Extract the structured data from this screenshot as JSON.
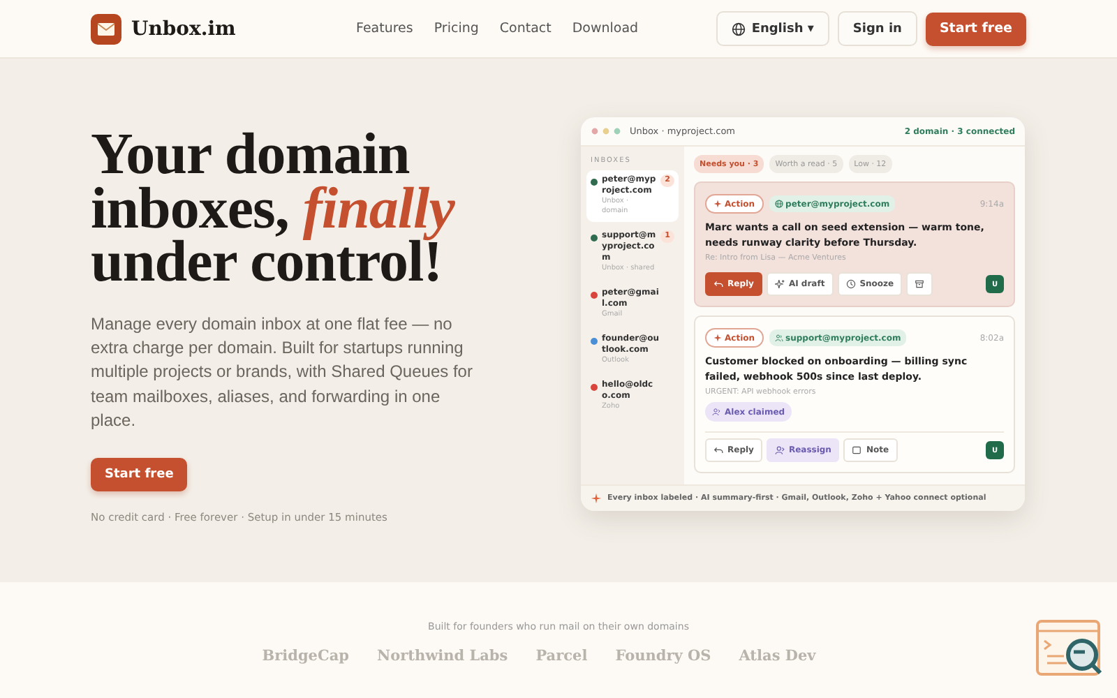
{
  "nav": {
    "brand": "Unbox.im",
    "links": [
      "Features",
      "Pricing",
      "Contact",
      "Download"
    ],
    "language": "English ▾",
    "sign_in": "Sign in",
    "cta": "Start free"
  },
  "hero": {
    "headline_before": "Your domain inboxes,",
    "headline_accent": "finally",
    "headline_after": "under control!",
    "description": "Manage every domain inbox at one flat fee — no extra charge per domain. Built for startups running multiple projects or brands, with Shared Queues for team mailboxes, aliases, and forwarding in one place.",
    "cta": "Start free",
    "note": "No credit card · Free forever · Setup in under 15 minutes"
  },
  "mockup": {
    "title": "Unbox · myproject.com",
    "status": "2 domain · 3 connected",
    "sidebar_heading": "INBOXES",
    "inboxes": [
      {
        "email": "peter@myproject.com",
        "sub": "Unbox · domain",
        "count": "2",
        "color": "#2f6b4f",
        "selected": true
      },
      {
        "email": "support@myproject.com",
        "sub": "Unbox · shared",
        "count": "1",
        "color": "#2f6b4f",
        "selected": false
      },
      {
        "email": "peter@gmail.com",
        "sub": "Gmail",
        "color": "#d9453c",
        "selected": false
      },
      {
        "email": "founder@outlook.com",
        "sub": "Outlook",
        "color": "#4a8fd6",
        "selected": false
      },
      {
        "email": "hello@oldco.com",
        "sub": "Zoho",
        "color": "#d9453c",
        "selected": false
      }
    ],
    "filters": [
      {
        "label": "Needs you · 3",
        "selected": true
      },
      {
        "label": "Worth a read · 5",
        "selected": false
      },
      {
        "label": "Low · 12",
        "selected": false
      }
    ],
    "cards": [
      {
        "highlighted": true,
        "tag": "Action",
        "address": {
          "kind": "domain",
          "label": "peter@myproject.com"
        },
        "time": "9:14a",
        "summary": "Marc wants a call on seed extension — warm tone, needs runway clarity before Thursday.",
        "subject": "Re: Intro from Lisa — Acme Ventures",
        "avatar": "U",
        "actions": [
          {
            "kind": "reply",
            "label": "Reply",
            "highlighted": true
          },
          {
            "kind": "ai_draft",
            "label": "AI draft",
            "highlighted": false
          },
          {
            "kind": "snooze",
            "label": "Snooze",
            "highlighted": false
          },
          {
            "kind": "archive",
            "highlighted": false
          }
        ]
      },
      {
        "highlighted": false,
        "tag": "Action",
        "address": {
          "kind": "shared",
          "label": "support@myproject.com"
        },
        "time": "8:02a",
        "summary": "Customer blocked on onboarding — billing sync failed, webhook 500s since last deploy.",
        "subject": "URGENT: API webhook errors",
        "claim": "Alex claimed",
        "avatar": "U",
        "actions": [
          {
            "kind": "reply",
            "label": "Reply",
            "highlighted": false
          },
          {
            "kind": "reassign",
            "label": "Reassign",
            "highlighted": true
          },
          {
            "kind": "note",
            "label": "Note",
            "highlighted": false
          }
        ]
      }
    ],
    "footer": "Every inbox labeled · AI summary-first · Gmail, Outlook, Zoho + Yahoo connect optional"
  },
  "logos": {
    "caption": "Built for founders who run mail on their own domains",
    "names": [
      "BridgeCap",
      "Northwind Labs",
      "Parcel",
      "Foundry OS",
      "Atlas Dev"
    ]
  }
}
